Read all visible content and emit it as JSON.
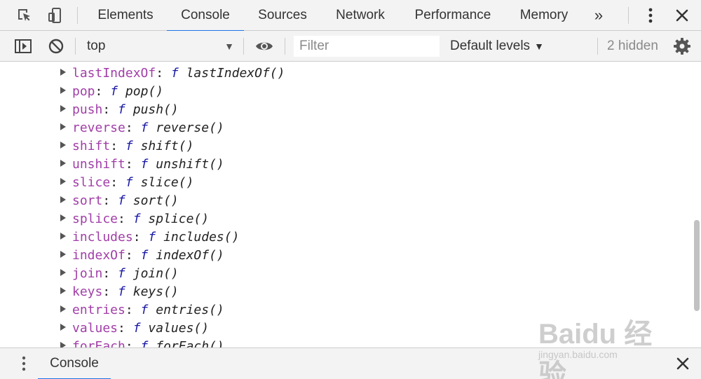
{
  "devtools": {
    "tabs": [
      {
        "label": "Elements"
      },
      {
        "label": "Console"
      },
      {
        "label": "Sources"
      },
      {
        "label": "Network"
      },
      {
        "label": "Performance"
      },
      {
        "label": "Memory"
      }
    ],
    "more_tabs_glyph": "»",
    "active_tab": "Console"
  },
  "console_toolbar": {
    "context": "top",
    "filter_placeholder": "Filter",
    "levels": "Default levels",
    "hidden": "2 hidden"
  },
  "console_output": {
    "rows": [
      {
        "key": "lastIndexOf",
        "fn": "f",
        "sig": "lastIndexOf()"
      },
      {
        "key": "pop",
        "fn": "f",
        "sig": "pop()"
      },
      {
        "key": "push",
        "fn": "f",
        "sig": "push()"
      },
      {
        "key": "reverse",
        "fn": "f",
        "sig": "reverse()"
      },
      {
        "key": "shift",
        "fn": "f",
        "sig": "shift()"
      },
      {
        "key": "unshift",
        "fn": "f",
        "sig": "unshift()"
      },
      {
        "key": "slice",
        "fn": "f",
        "sig": "slice()"
      },
      {
        "key": "sort",
        "fn": "f",
        "sig": "sort()"
      },
      {
        "key": "splice",
        "fn": "f",
        "sig": "splice()"
      },
      {
        "key": "includes",
        "fn": "f",
        "sig": "includes()"
      },
      {
        "key": "indexOf",
        "fn": "f",
        "sig": "indexOf()"
      },
      {
        "key": "join",
        "fn": "f",
        "sig": "join()"
      },
      {
        "key": "keys",
        "fn": "f",
        "sig": "keys()"
      },
      {
        "key": "entries",
        "fn": "f",
        "sig": "entries()"
      },
      {
        "key": "values",
        "fn": "f",
        "sig": "values()"
      },
      {
        "key": "forEach",
        "fn": "f",
        "sig": "forEach()"
      }
    ]
  },
  "drawer": {
    "tab": "Console"
  },
  "watermark": {
    "logo": "Baidu 经验",
    "url": "jingyan.baidu.com"
  },
  "colors": {
    "accent": "#1a73e8",
    "property_key": "#a13ea8",
    "function_keyword": "#1a1aa6",
    "toolbar_bg": "#f3f3f3"
  },
  "icons": [
    "inspect-element-icon",
    "device-toolbar-icon",
    "more-tabs-icon",
    "kebab-menu-icon",
    "close-icon",
    "sidebar-toggle-icon",
    "clear-console-icon",
    "eye-icon",
    "gear-icon",
    "drawer-menu-icon",
    "drawer-close-icon"
  ]
}
